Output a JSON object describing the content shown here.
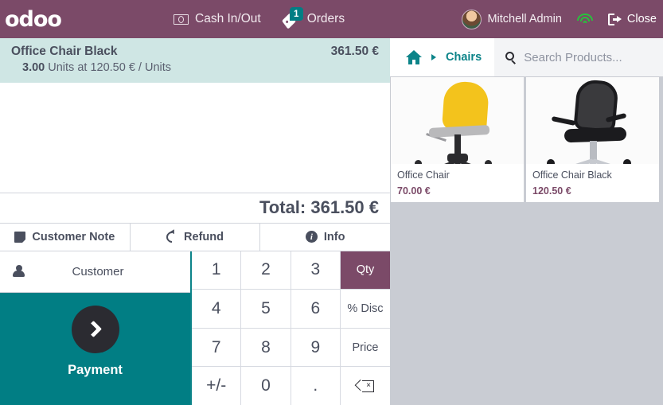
{
  "topbar": {
    "logo": "odoo",
    "cash_label": "Cash In/Out",
    "orders_label": "Orders",
    "orders_badge": "1",
    "user_name": "Mitchell Admin",
    "close_label": "Close",
    "bg_color": "#7b4a68",
    "badge_color": "#017e84",
    "wifi_color": "#27c23c"
  },
  "order": {
    "lines": [
      {
        "name": "Office Chair Black",
        "subtotal": "361.50 €",
        "qty": "3.00",
        "detail": "Units at 120.50 € / Units",
        "selected": true
      }
    ],
    "total_label": "Total: 361.50 €",
    "actions": [
      {
        "label": "Customer Note",
        "icon": "note-icon"
      },
      {
        "label": "Refund",
        "icon": "refund-icon"
      },
      {
        "label": "Info",
        "icon": "info-icon"
      }
    ],
    "selected_line_color": "#cfe6e4"
  },
  "payment": {
    "customer_label": "Customer",
    "payment_label": "Payment",
    "panel_color": "#017e84"
  },
  "numpad": {
    "rows": [
      [
        {
          "label": "1",
          "type": "digit"
        },
        {
          "label": "2",
          "type": "digit"
        },
        {
          "label": "3",
          "type": "digit"
        },
        {
          "label": "Qty",
          "type": "mode",
          "active": true
        }
      ],
      [
        {
          "label": "4",
          "type": "digit"
        },
        {
          "label": "5",
          "type": "digit"
        },
        {
          "label": "6",
          "type": "digit"
        },
        {
          "label": "% Disc",
          "type": "mode",
          "active": false
        }
      ],
      [
        {
          "label": "7",
          "type": "digit"
        },
        {
          "label": "8",
          "type": "digit"
        },
        {
          "label": "9",
          "type": "digit"
        },
        {
          "label": "Price",
          "type": "mode",
          "active": false
        }
      ],
      [
        {
          "label": "+/-",
          "type": "digit"
        },
        {
          "label": "0",
          "type": "digit"
        },
        {
          "label": ".",
          "type": "digit"
        },
        {
          "label": "",
          "type": "backspace"
        }
      ]
    ],
    "active_mode_color": "#7b4a68"
  },
  "products": {
    "breadcrumb": {
      "home": "home-icon",
      "category": "Chairs"
    },
    "search_placeholder": "Search Products...",
    "items": [
      {
        "name": "Office Chair",
        "price": "70.00 €",
        "art": "chair-yellow"
      },
      {
        "name": "Office Chair Black",
        "price": "120.50 €",
        "art": "chair-black"
      }
    ],
    "price_color": "#7b4a68",
    "grid_bg": "#c9ccd3"
  }
}
